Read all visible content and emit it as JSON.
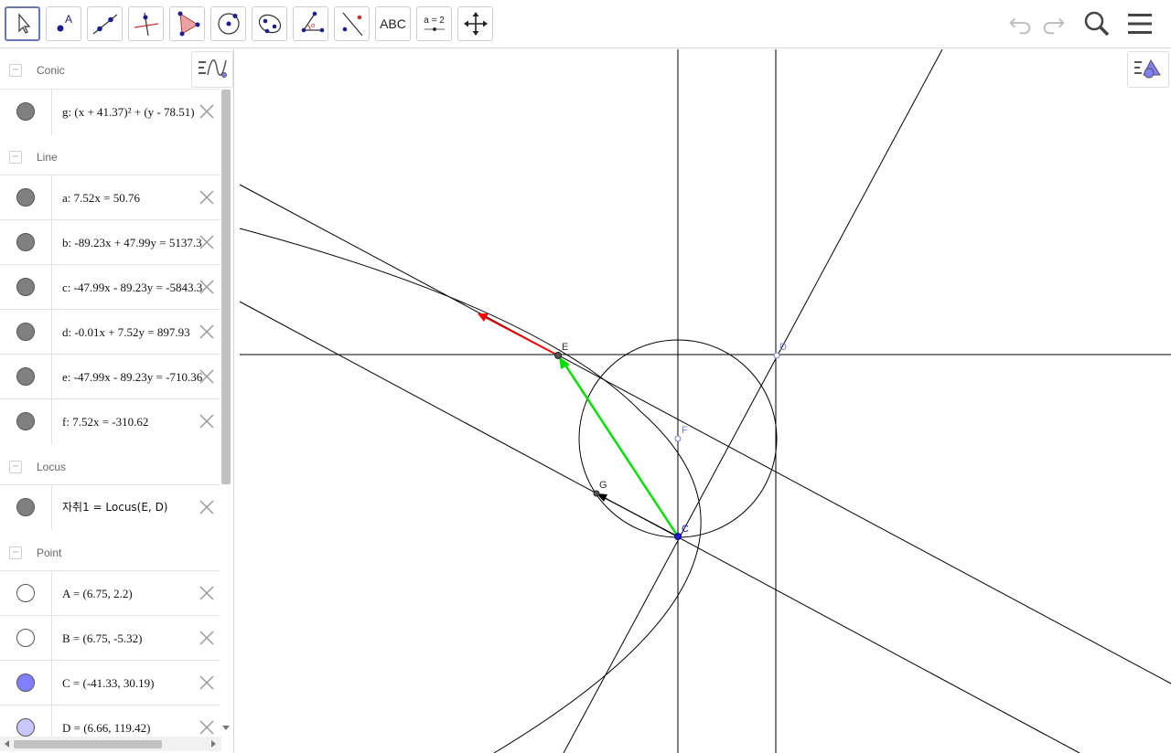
{
  "toolbar": {
    "tools": [
      {
        "name": "move-tool",
        "icon": "cursor-arrow-icon"
      },
      {
        "name": "point-tool",
        "icon": "point-icon"
      },
      {
        "name": "line-tool",
        "icon": "line-icon"
      },
      {
        "name": "perpendicular-tool",
        "icon": "perpendicular-icon"
      },
      {
        "name": "polygon-tool",
        "icon": "polygon-icon"
      },
      {
        "name": "circle-tool",
        "icon": "circle-center-icon"
      },
      {
        "name": "ellipse-tool",
        "icon": "ellipse-icon"
      },
      {
        "name": "angle-tool",
        "icon": "angle-icon"
      },
      {
        "name": "reflect-tool",
        "icon": "reflect-icon"
      },
      {
        "name": "text-tool",
        "icon": "text-icon",
        "label": "ABC"
      },
      {
        "name": "slider-tool",
        "icon": "slider-icon",
        "label": "a = 2"
      },
      {
        "name": "move-graphics-tool",
        "icon": "move-arrows-icon"
      }
    ],
    "right": {
      "undo": "undo-icon",
      "redo": "redo-icon",
      "search": "search-icon",
      "menu": "hamburger-menu-icon"
    }
  },
  "algebra": {
    "groups": [
      {
        "title": "Conic",
        "items": [
          {
            "expr": "g: (x + 41.37)² + (y - 78.51)",
            "marble": "#808080"
          }
        ]
      },
      {
        "title": "Line",
        "items": [
          {
            "expr": "a: 7.52x = 50.76",
            "marble": "#808080"
          },
          {
            "expr": "b: -89.23x + 47.99y = 5137.3",
            "marble": "#808080"
          },
          {
            "expr": "c: -47.99x - 89.23y = -5843.3",
            "marble": "#808080"
          },
          {
            "expr": "d: -0.01x + 7.52y = 897.93",
            "marble": "#808080"
          },
          {
            "expr": "e: -47.99x - 89.23y = -710.36",
            "marble": "#808080"
          },
          {
            "expr": "f: 7.52x = -310.62",
            "marble": "#808080"
          }
        ]
      },
      {
        "title": "Locus",
        "items": [
          {
            "expr": "자취1 = Locus(E, D)",
            "marble": "#808080"
          }
        ]
      },
      {
        "title": "Point",
        "items": [
          {
            "expr": "A = (6.75, 2.2)",
            "marble": "#ffffff"
          },
          {
            "expr": "B = (6.75, -5.32)",
            "marble": "#ffffff"
          },
          {
            "expr": "C = (-41.33, 30.19)",
            "marble": "#8080ff"
          },
          {
            "expr": "D = (6.66, 119.42)",
            "marble": "#c8c8ff"
          }
        ]
      }
    ],
    "style_bar_icon": "algebra-style-icon"
  },
  "graphics": {
    "points": [
      {
        "label": "E",
        "color": "#333333"
      },
      {
        "label": "D",
        "color": "#7b7bd6"
      },
      {
        "label": "F",
        "color": "#7b7bd6"
      },
      {
        "label": "G",
        "color": "#333333"
      },
      {
        "label": "C",
        "color": "#1a1ad0"
      }
    ],
    "style_bar_icon": "graphics-style-icon",
    "colors": {
      "vector_red": "#ff0000",
      "vector_green": "#00e000",
      "line": "#000000"
    }
  }
}
